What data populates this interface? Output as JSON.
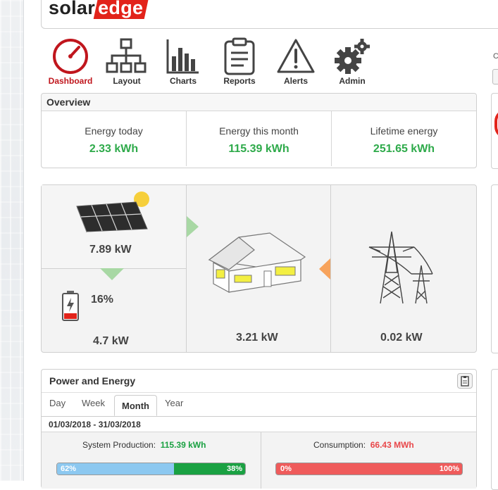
{
  "brand": {
    "solar": "solar",
    "edge": "edge"
  },
  "nav": [
    {
      "label": "Dashboard",
      "icon": "speedometer-icon"
    },
    {
      "label": "Layout",
      "icon": "sitemap-icon"
    },
    {
      "label": "Charts",
      "icon": "bar-chart-icon"
    },
    {
      "label": "Reports",
      "icon": "clipboard-icon"
    },
    {
      "label": "Alerts",
      "icon": "warning-icon"
    },
    {
      "label": "Admin",
      "icon": "gears-icon"
    }
  ],
  "right_edge": {
    "label": "C"
  },
  "overview": {
    "title": "Overview",
    "items": [
      {
        "label": "Energy today",
        "value": "2.33 kWh"
      },
      {
        "label": "Energy this month",
        "value": "115.39 kWh"
      },
      {
        "label": "Lifetime energy",
        "value": "251.65 kWh"
      }
    ]
  },
  "power_flow": {
    "pv_power": "7.89 kW",
    "battery_percent": "16%",
    "battery_power": "4.7 kW",
    "load_power": "3.21 kW",
    "grid_power": "0.02 kW",
    "battery_level": 0.16
  },
  "power_energy": {
    "title": "Power and Energy",
    "tabs": [
      "Day",
      "Week",
      "Month",
      "Year"
    ],
    "active_tab": "Month",
    "date_range": "01/03/2018 - 31/03/2018",
    "production": {
      "label": "System Production:",
      "value": "115.39 kWh",
      "left_pct_label": "62%",
      "right_pct_label": "38%",
      "left_fraction": 0.62
    },
    "consumption": {
      "label": "Consumption:",
      "value": "66.43 MWh",
      "left_pct_label": "0%",
      "right_pct_label": "100%"
    }
  },
  "colors": {
    "accent_red": "#c0161d",
    "value_green": "#2eaa4a",
    "consumption_red": "#e8474a",
    "bar_blue": "#8cc8f0",
    "bar_green": "#1aa142",
    "bar_red": "#ef5b5b"
  }
}
